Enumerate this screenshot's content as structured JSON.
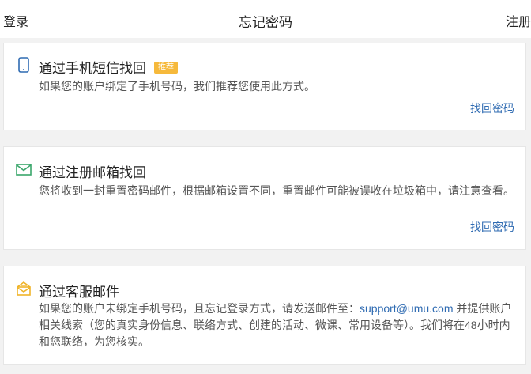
{
  "header": {
    "login_label": "登录",
    "title": "忘记密码",
    "register_label": "注册"
  },
  "methods": {
    "sms": {
      "title": "通过手机短信找回",
      "badge": "推荐",
      "desc": "如果您的账户绑定了手机号码，我们推荐您使用此方式。",
      "action": "找回密码",
      "icon": "phone-icon"
    },
    "email": {
      "title": "通过注册邮箱找回",
      "desc": "您将收到一封重置密码邮件，根据邮箱设置不同，重置邮件可能被误收在垃圾箱中，请注意查看。",
      "action": "找回密码",
      "icon": "mail-icon"
    },
    "support": {
      "title": "通过客服邮件",
      "desc_prefix": "如果您的账户未绑定手机号码，且忘记登录方式，请发送邮件至：",
      "email": "support@umu.com",
      "desc_suffix": " 并提供账户相关线索（您的真实身份信息、联络方式、创建的活动、微课、常用设备等）。我们将在48小时内和您联络，为您核实。",
      "icon": "envelope-open-icon"
    }
  },
  "colors": {
    "link": "#2f6bb2",
    "badge": "#f6b93b",
    "phone_icon": "#2f6bb2",
    "mail_icon": "#3aa66b",
    "support_icon": "#f0b429"
  }
}
